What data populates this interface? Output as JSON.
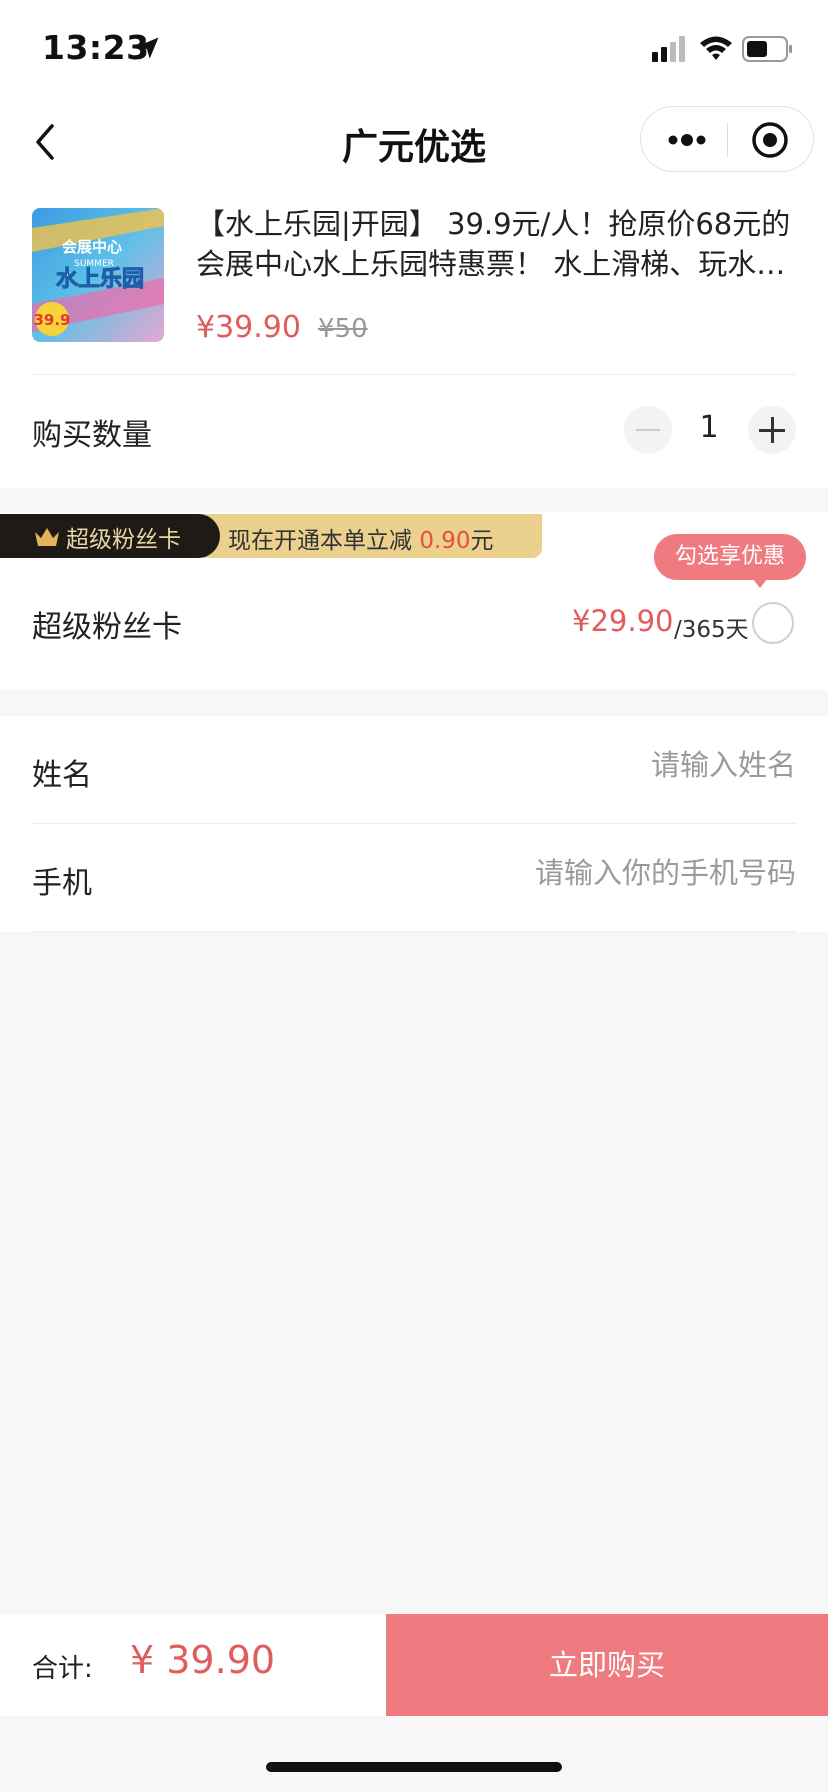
{
  "status_bar": {
    "time": "13:23"
  },
  "nav": {
    "title": "广元优选"
  },
  "product": {
    "title": "【水上乐园|开园】 39.9元/人！抢原价68元的会展中心水上乐园特惠票！ 水上滑梯、玩水…",
    "price": "¥39.90",
    "original_price": "¥50",
    "thumb_text_top": "会展中心",
    "thumb_text_main": "水上乐园",
    "thumb_text_sub": "SUMMER",
    "thumb_badge": "39.9"
  },
  "quantity": {
    "label": "购买数量",
    "value": "1"
  },
  "fan_card": {
    "banner_label": "超级粉丝卡",
    "promo_prefix": "现在开通本单立减 ",
    "promo_amount": "0.90",
    "promo_suffix": "元",
    "tooltip": "勾选享优惠",
    "label": "超级粉丝卡",
    "price": "¥29.90",
    "period": "/365天"
  },
  "form": {
    "name": {
      "label": "姓名",
      "placeholder": "请输入姓名",
      "value": ""
    },
    "phone": {
      "label": "手机",
      "placeholder": "请输入你的手机号码",
      "value": ""
    }
  },
  "footer": {
    "total_label": "合计:",
    "total_value": "¥ 39.90",
    "buy_label": "立即购买"
  },
  "colors": {
    "accent": "#e05d5d",
    "button": "#ef7b80",
    "gold": "#ebd08e",
    "dark": "#1e1a16"
  }
}
